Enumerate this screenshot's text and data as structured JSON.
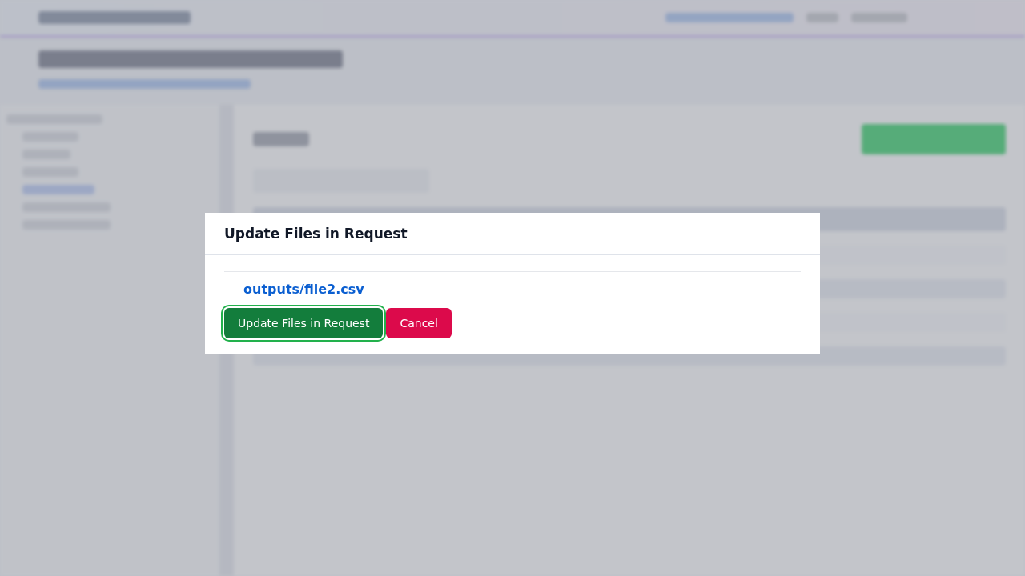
{
  "dialog": {
    "title": "Update Files in Request",
    "files": [
      {
        "path": "outputs/file2.csv"
      }
    ],
    "buttons": [
      {
        "label": "Update Files in Request",
        "kind": "primary",
        "focused": true
      },
      {
        "label": "Cancel",
        "kind": "danger",
        "focused": false
      }
    ]
  }
}
